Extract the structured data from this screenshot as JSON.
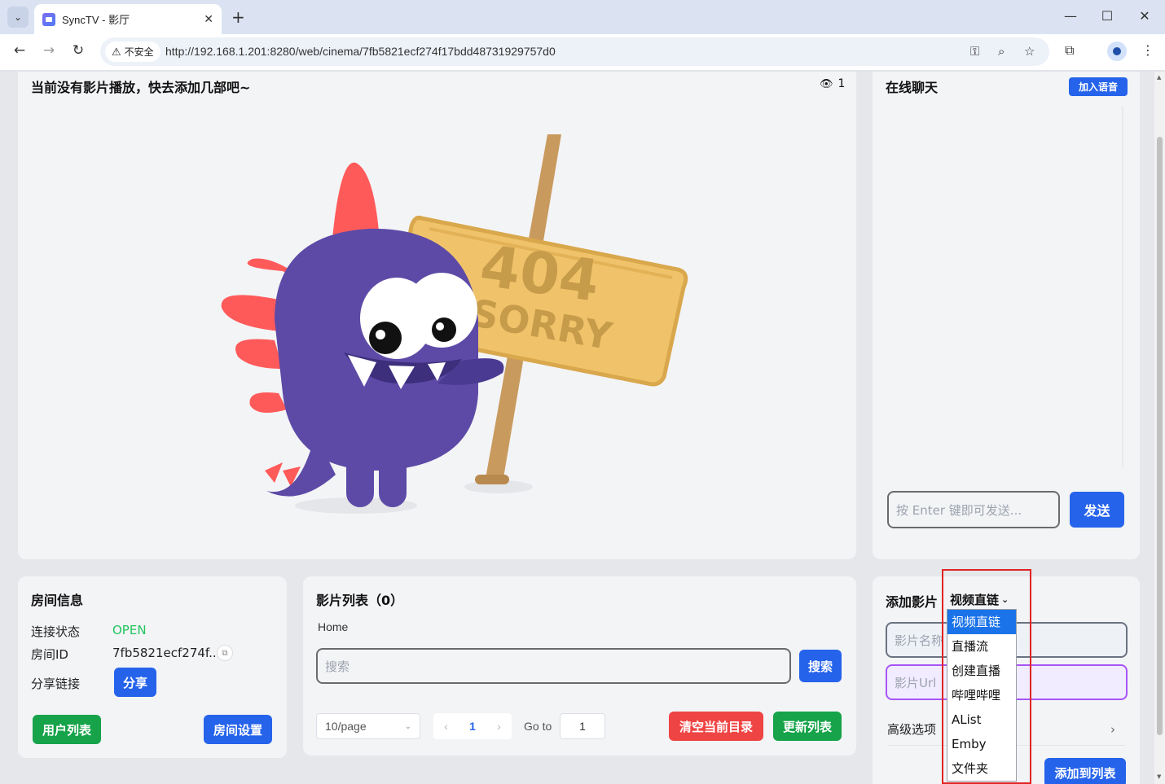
{
  "browser": {
    "tab_title": "SyncTV - 影厅",
    "not_secure_label": "不安全",
    "url": "http://192.168.1.201:8280/web/cinema/7fb5821ecf274f17bdd48731929757d0",
    "icons": [
      "tab-search-icon",
      "close-icon",
      "plus-icon",
      "minimize-icon",
      "maximize-icon",
      "window-close-icon",
      "back-icon",
      "forward-icon",
      "reload-icon",
      "warning-icon",
      "password-key-icon",
      "zoom-icon",
      "star-icon",
      "extensions-icon",
      "profile-icon",
      "menu-icon"
    ]
  },
  "player": {
    "title": "当前没有影片播放，快去添加几部吧~",
    "viewer_count": "1",
    "sign_line1": "404",
    "sign_line2": "SORRY"
  },
  "chat": {
    "title": "在线聊天",
    "join_voice": "加入语音",
    "input_placeholder": "按 Enter 键即可发送...",
    "send": "发送"
  },
  "room": {
    "title": "房间信息",
    "status_label": "连接状态",
    "status_value": "OPEN",
    "id_label": "房间ID",
    "id_value": "7fb5821ecf274f...",
    "share_label": "分享链接",
    "share_button": "分享",
    "user_list": "用户列表",
    "settings": "房间设置"
  },
  "movies": {
    "title": "影片列表（0）",
    "breadcrumb": "Home",
    "search_placeholder": "搜索",
    "search_button": "搜索",
    "page_size": "10/page",
    "current_page": "1",
    "goto_label": "Go to",
    "goto_value": "1",
    "clear_button": "清空当前目录",
    "refresh_button": "更新列表"
  },
  "add_movie": {
    "title": "添加影片",
    "type_selected": "视频直链",
    "name_placeholder": "影片名称",
    "url_placeholder": "影片Url",
    "advanced": "高级选项",
    "add_button": "添加到列表",
    "type_options": [
      "视频直链",
      "直播流",
      "创建直播",
      "哔哩哔哩",
      "AList",
      "Emby",
      "文件夹"
    ]
  },
  "colors": {
    "accent": "#2563eb",
    "success": "#16a34a",
    "danger": "#ef4444",
    "status_open": "#22c55e",
    "highlight_box": "#e02424",
    "dino": "#5d4aa6",
    "spikes": "#ff5a5a",
    "sign": "#f0c36a"
  }
}
